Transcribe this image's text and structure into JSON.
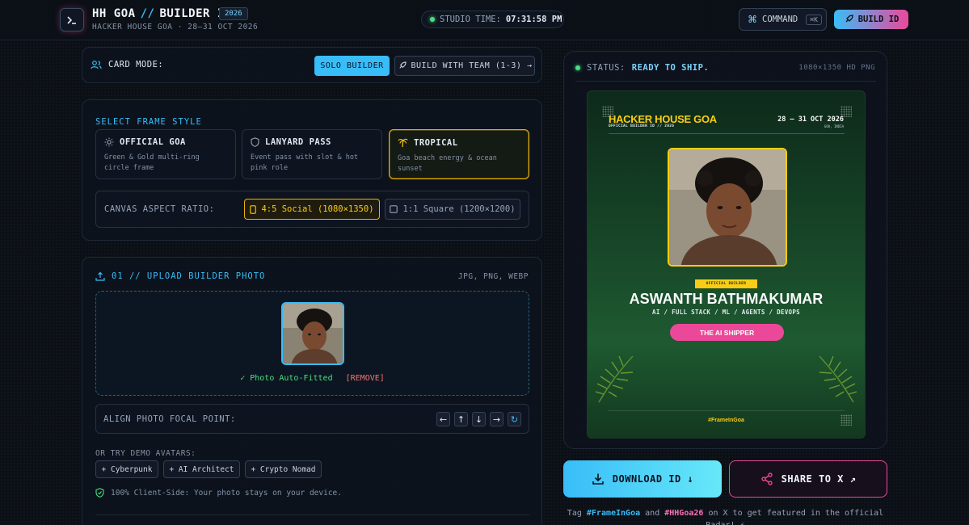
{
  "header": {
    "title_left": "HH GOA",
    "title_sep": "//",
    "title_right": "BUILDER ID",
    "year_badge": "2026",
    "subtitle": "HACKER HOUSE GOA · 28–31 OCT 2026",
    "studio_label": "STUDIO TIME:",
    "studio_time": "07:31:58 PM",
    "command_label": "COMMAND",
    "command_shortcut": "⌘K",
    "build_label": "BUILD ID"
  },
  "card_mode": {
    "label": "CARD MODE:",
    "solo": "SOLO BUILDER",
    "team": "BUILD WITH TEAM (1-3) →"
  },
  "frame_style": {
    "title": "SELECT FRAME STYLE",
    "options": [
      {
        "name": "OFFICIAL GOA",
        "desc": "Green & Gold multi-ring circle frame"
      },
      {
        "name": "LANYARD PASS",
        "desc": "Event pass with slot & hot pink role"
      },
      {
        "name": "TROPICAL",
        "desc": "Goa beach energy & ocean sunset"
      }
    ],
    "selected": "TROPICAL",
    "aspect_label": "CANVAS ASPECT RATIO:",
    "aspect_options": [
      "4:5 Social (1080×1350)",
      "1:1 Square (1200×1200)"
    ],
    "aspect_selected": "4:5 Social (1080×1350)"
  },
  "upload": {
    "title": "01 // UPLOAD BUILDER PHOTO",
    "formats": "JPG, PNG, WEBP",
    "fitted": "✓ Photo Auto-Fitted",
    "remove": "[REMOVE]",
    "focal_label": "ALIGN PHOTO FOCAL POINT:",
    "arrows": [
      "←",
      "↑",
      "↓",
      "→",
      "↻"
    ],
    "demo_label": "OR TRY DEMO AVATARS:",
    "demos": [
      "+ Cyberpunk",
      "+ AI Architect",
      "+ Crypto Nomad"
    ],
    "client_side": "100% Client-Side: Your photo stays on your device."
  },
  "preview": {
    "status_label": "STATUS:",
    "status_value": "READY TO SHIP.",
    "resolution": "1080×1350 HD PNG"
  },
  "card": {
    "brand": "HACKER HOUSE GOA",
    "brand_sub": "OFFICIAL BUILDER ID // 2026",
    "date": "28 — 31 OCT 2026",
    "location": "GOA, INDIA",
    "official_tag": "OFFICIAL BUILDER",
    "name": "ASWANTH BATHMAKUMAR",
    "role": "AI / FULL STACK / ML / AGENTS / DEVOPS",
    "pill": "THE AI SHIPPER",
    "hashtag": "#FrameInGoa"
  },
  "actions": {
    "download": "DOWNLOAD ID ↓",
    "share": "SHARE TO X ↗",
    "tag_pre": "Tag",
    "tag1": "#FrameInGoa",
    "tag_and": "and",
    "tag2": "#HHGoa26",
    "tag_post": "on X to get featured in the official Radar! ⚡"
  },
  "colors": {
    "accent_blue": "#38bdf8",
    "accent_pink": "#ec4899",
    "accent_gold": "#facc15",
    "status_green": "#4ade80"
  }
}
